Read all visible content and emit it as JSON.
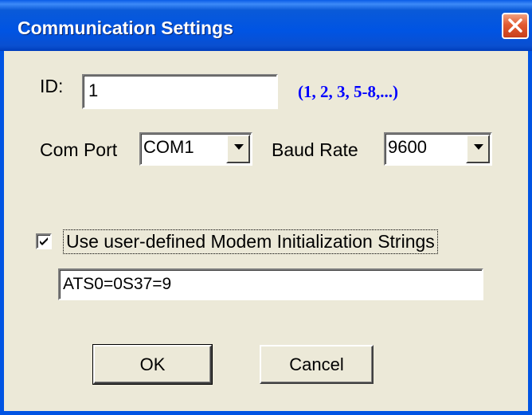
{
  "window": {
    "title": "Communication Settings"
  },
  "form": {
    "id_label": "ID:",
    "id_value": "1",
    "id_hint": "(1, 2, 3, 5-8,...)",
    "com_port_label": "Com Port",
    "com_port_value": "COM1",
    "baud_rate_label": "Baud Rate",
    "baud_rate_value": "9600",
    "modem_checkbox_label": "Use user-defined Modem Initialization Strings",
    "modem_checkbox_checked": true,
    "modem_init_value": "ATS0=0S37=9"
  },
  "buttons": {
    "ok_label": "OK",
    "cancel_label": "Cancel"
  },
  "colors": {
    "titlebar": "#0054e3",
    "hint_text": "#0000ff",
    "dialog_bg": "#ece9d8",
    "close_button": "#e25a30"
  },
  "icons": {
    "close": "close-icon",
    "dropdown": "chevron-down-icon",
    "check": "check-icon"
  }
}
